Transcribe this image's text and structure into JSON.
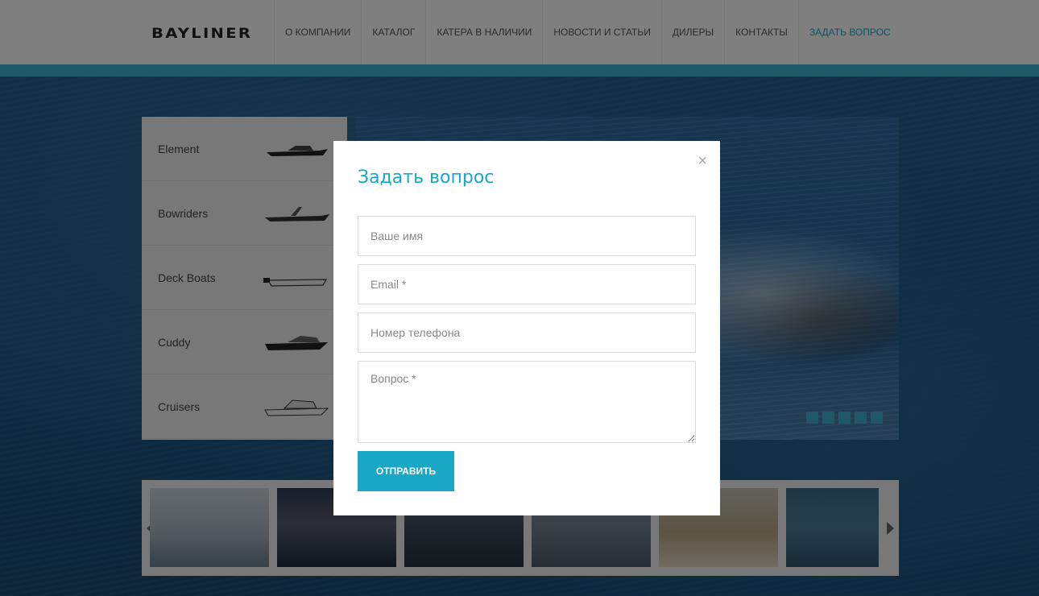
{
  "header": {
    "logo": "BAYLINER",
    "nav": [
      "О КОМПАНИИ",
      "КАТАЛОГ",
      "КАТЕРА В НАЛИЧИИ",
      "НОВОСТИ И СТАТЬИ",
      "ДИЛЕРЫ",
      "КОНТАКТЫ",
      "ЗАДАТЬ ВОПРОС"
    ]
  },
  "catalog": [
    {
      "label": "Element",
      "icon": "boat-icon"
    },
    {
      "label": "Bowriders",
      "icon": "boat-icon"
    },
    {
      "label": "Deck Boats",
      "icon": "boat-icon"
    },
    {
      "label": "Cuddy",
      "icon": "boat-icon"
    },
    {
      "label": "Cruisers",
      "icon": "boat-icon"
    }
  ],
  "slider": {
    "dot_count": 5
  },
  "modal": {
    "close_symbol": "×",
    "title": "Задать вопрос",
    "fields": {
      "name_placeholder": "Ваше имя",
      "email_placeholder": "Email *",
      "phone_placeholder": "Номер телефона",
      "question_placeholder": "Вопрос *"
    },
    "submit_label": "ОТПРАВИТЬ"
  },
  "colors": {
    "accent": "#19a7c6",
    "strip": "#3bb4cf"
  }
}
